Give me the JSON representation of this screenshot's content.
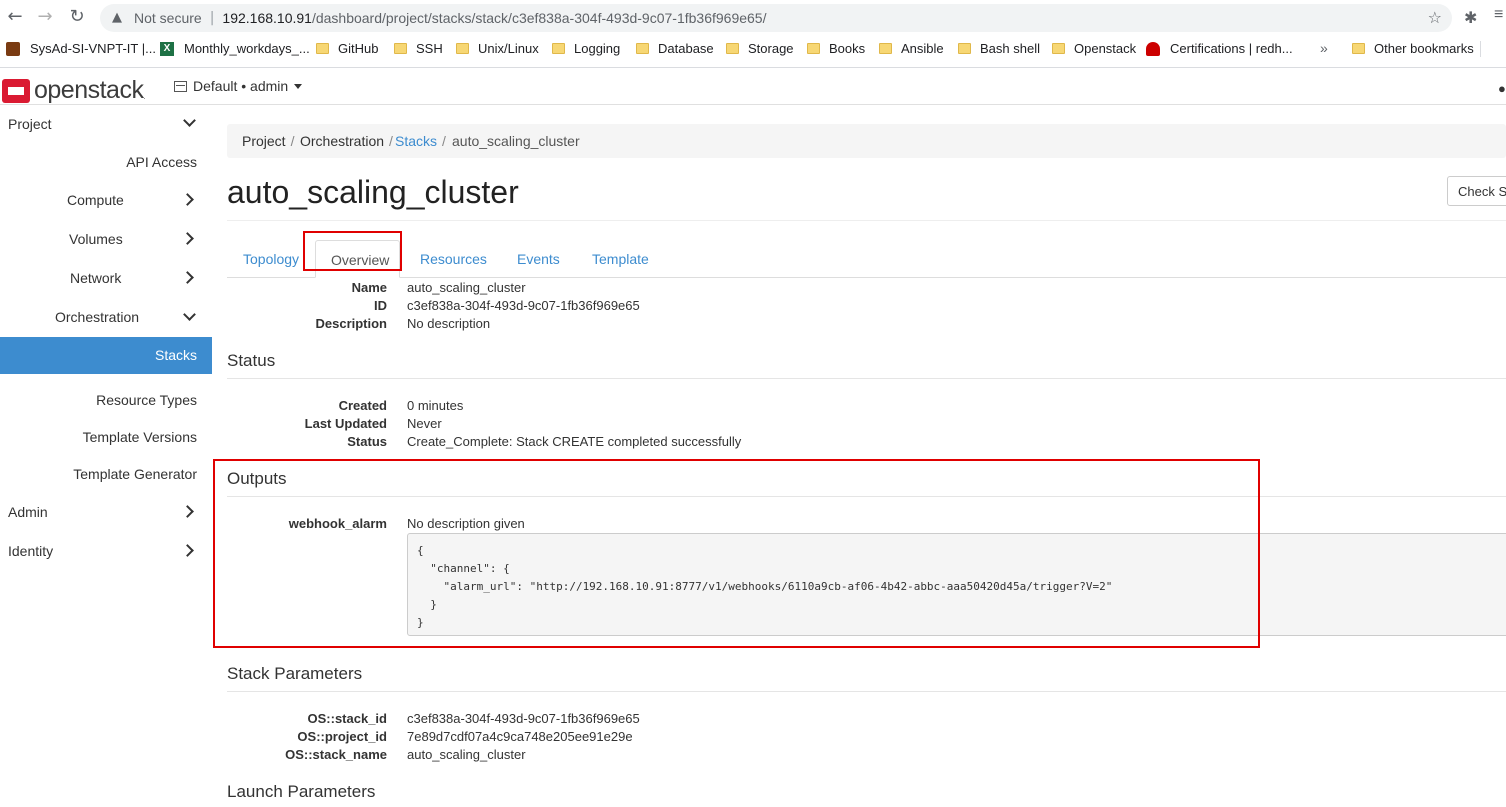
{
  "browser": {
    "not_secure": "Not secure",
    "url_host": "192.168.10.91",
    "url_path": "/dashboard/project/stacks/stack/c3ef838a-304f-493d-9c07-1fb36f969e65/",
    "bookmarks": [
      {
        "label": "SysAd-SI-VNPT-IT |...",
        "icon": "trello-icon"
      },
      {
        "label": "Monthly_workdays_...",
        "icon": "excel-icon"
      },
      {
        "label": "GitHub",
        "icon": "folder-icon"
      },
      {
        "label": "SSH",
        "icon": "folder-icon"
      },
      {
        "label": "Unix/Linux",
        "icon": "folder-icon"
      },
      {
        "label": "Logging",
        "icon": "folder-icon"
      },
      {
        "label": "Database",
        "icon": "folder-icon"
      },
      {
        "label": "Storage",
        "icon": "folder-icon"
      },
      {
        "label": "Books",
        "icon": "folder-icon"
      },
      {
        "label": "Ansible",
        "icon": "folder-icon"
      },
      {
        "label": "Bash shell",
        "icon": "folder-icon"
      },
      {
        "label": "Openstack",
        "icon": "folder-icon"
      },
      {
        "label": "Certifications | redh...",
        "icon": "redhat-icon"
      }
    ],
    "more_bookmarks": "»",
    "other_bookmarks": "Other bookmarks"
  },
  "header": {
    "logo_text": "openstack",
    "logo_reg": ".",
    "context": "Default • admin"
  },
  "sidebar": {
    "project": "Project",
    "api_access": "API Access",
    "compute": "Compute",
    "volumes": "Volumes",
    "network": "Network",
    "orchestration": "Orchestration",
    "stacks": "Stacks",
    "resource_types": "Resource Types",
    "template_versions": "Template Versions",
    "template_generator": "Template Generator",
    "admin": "Admin",
    "identity": "Identity"
  },
  "breadcrumb": {
    "project": "Project",
    "orchestration": "Orchestration",
    "stacks": "Stacks",
    "current": "auto_scaling_cluster",
    "slash": "/"
  },
  "page": {
    "title": "auto_scaling_cluster",
    "check_button": "Check Stack"
  },
  "tabs": {
    "topology": "Topology",
    "overview": "Overview",
    "resources": "Resources",
    "events": "Events",
    "template": "Template"
  },
  "overview": {
    "name_key": "Name",
    "name_val": "auto_scaling_cluster",
    "id_key": "ID",
    "id_val": "c3ef838a-304f-493d-9c07-1fb36f969e65",
    "desc_key": "Description",
    "desc_val": "No description"
  },
  "status": {
    "heading": "Status",
    "created_key": "Created",
    "created_val": "0 minutes",
    "updated_key": "Last Updated",
    "updated_val": "Never",
    "status_key": "Status",
    "status_val": "Create_Complete: Stack CREATE completed successfully"
  },
  "outputs": {
    "heading": "Outputs",
    "key": "webhook_alarm",
    "desc": "No description given",
    "code": "{\n  \"channel\": {\n    \"alarm_url\": \"http://192.168.10.91:8777/v1/webhooks/6110a9cb-af06-4b42-abbc-aaa50420d45a/trigger?V=2\"\n  }\n}"
  },
  "stack_params": {
    "heading": "Stack Parameters",
    "stack_id_key": "OS::stack_id",
    "stack_id_val": "c3ef838a-304f-493d-9c07-1fb36f969e65",
    "project_id_key": "OS::project_id",
    "project_id_val": "7e89d7cdf07a4c9ca748e205ee91e29e",
    "stack_name_key": "OS::stack_name",
    "stack_name_val": "auto_scaling_cluster"
  },
  "launch_params": {
    "heading": "Launch Parameters"
  },
  "colors": {
    "accent": "#3d8ccf",
    "highlight": "#e00000",
    "brand": "#da1a32"
  }
}
